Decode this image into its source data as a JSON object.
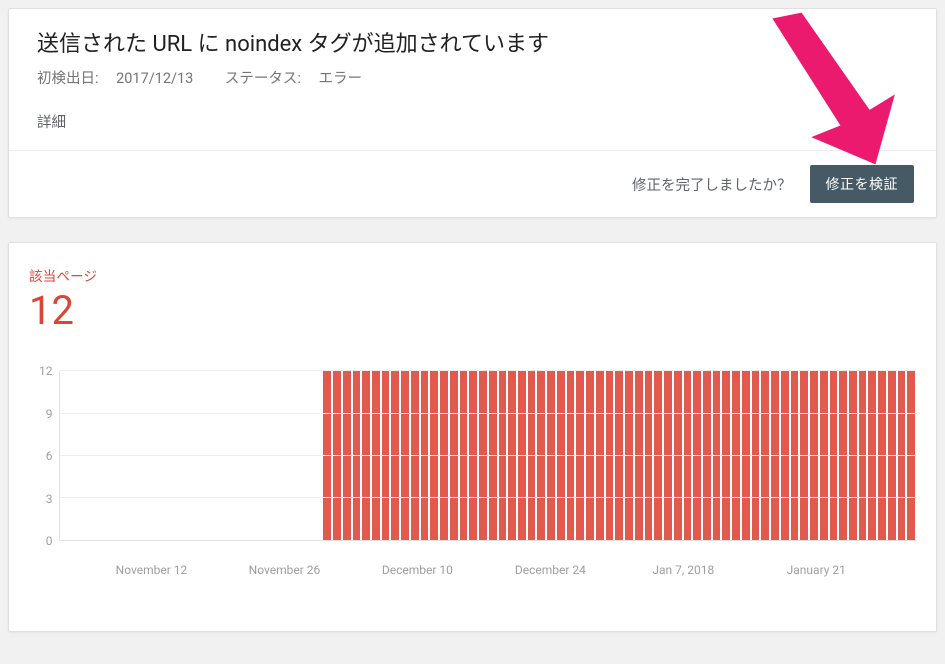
{
  "header": {
    "title": "送信された URL に noindex タグが追加されています",
    "first_detected_label": "初検出日:",
    "first_detected_value": "2017/12/13",
    "status_label": "ステータス:",
    "status_value": "エラー",
    "details_label": "詳細"
  },
  "actions": {
    "prompt": "修正を完了しましたか？",
    "validate_button": "修正を検証"
  },
  "chart": {
    "label": "該当ページ",
    "count": "12"
  },
  "chart_data": {
    "type": "bar",
    "title": "該当ページ",
    "ylabel": "",
    "xlabel": "",
    "ylim": [
      0,
      12
    ],
    "y_ticks": [
      12,
      9,
      6,
      3,
      0
    ],
    "x_ticks": [
      "November 12",
      "November 26",
      "December 10",
      "December 24",
      "Jan 7, 2018",
      "January 21"
    ],
    "x_tick_positions_pct": [
      8,
      24,
      40,
      56,
      72,
      88
    ],
    "series": [
      {
        "name": "該当ページ",
        "color": "#e25a4d",
        "values": [
          0,
          0,
          0,
          0,
          0,
          0,
          0,
          0,
          0,
          0,
          0,
          0,
          0,
          0,
          0,
          0,
          0,
          0,
          0,
          0,
          0,
          0,
          0,
          0,
          0,
          0,
          0,
          12,
          12,
          12,
          12,
          12,
          12,
          12,
          12,
          12,
          12,
          12,
          12,
          12,
          12,
          12,
          12,
          12,
          12,
          12,
          12,
          12,
          12,
          12,
          12,
          12,
          12,
          12,
          12,
          12,
          12,
          12,
          12,
          12,
          12,
          12,
          12,
          12,
          12,
          12,
          12,
          12,
          12,
          12,
          12,
          12,
          12,
          12,
          12,
          12,
          12,
          12,
          12,
          12,
          12,
          12,
          12,
          12,
          12,
          12,
          12,
          12
        ]
      }
    ]
  },
  "annotation": {
    "arrow_color": "#ec1a6f"
  }
}
